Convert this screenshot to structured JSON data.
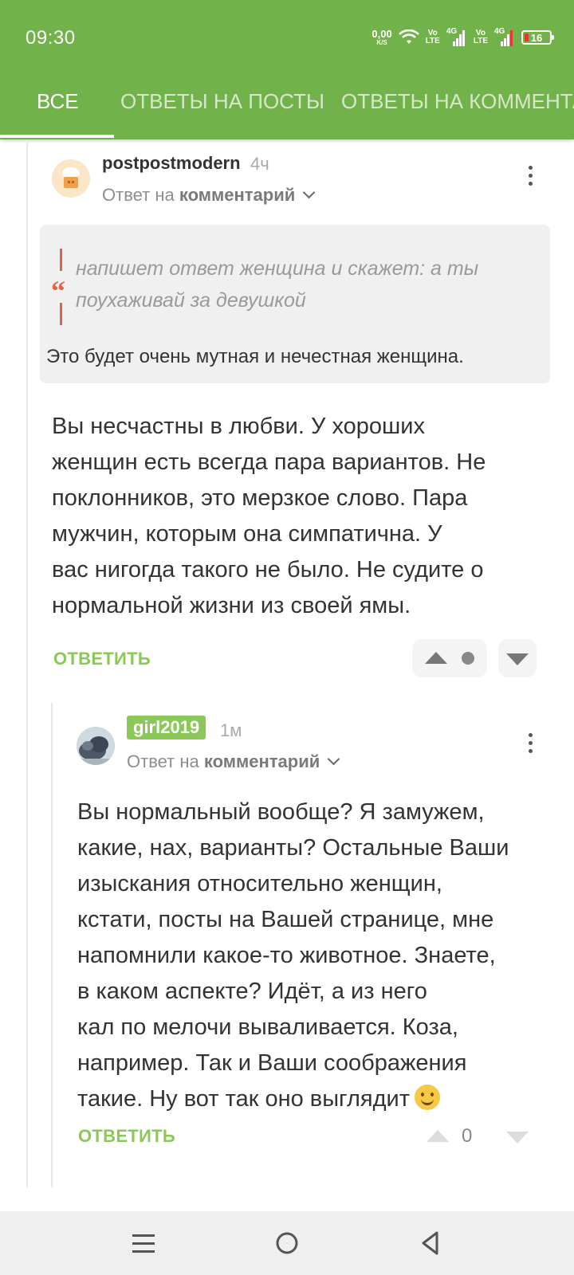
{
  "status_bar": {
    "time": "09:30",
    "net_speed_value": "0,00",
    "net_speed_unit": "K/S",
    "volte1": [
      "Vo",
      "LTE"
    ],
    "sig1_label": "4G",
    "volte2": [
      "Vo",
      "LTE"
    ],
    "sig2_label": "4G",
    "battery": "16"
  },
  "tabs": [
    {
      "label": "Все",
      "active": true
    },
    {
      "label": "Ответы на посты",
      "active": false
    },
    {
      "label": "Ответы на комментарии",
      "active": false
    }
  ],
  "comments": [
    {
      "author": "postpostmodern",
      "time": "4ч",
      "reply_prefix": "Ответ на",
      "reply_target": "комментарий",
      "quote_lines": [
        "напишет ответ женщина и скажет: а ты",
        "поухаживай за девушкой"
      ],
      "quote_mark": "“",
      "quote_reply": "Это будет очень мутная и нечестная женщина.",
      "body_lines": [
        "Вы несчастны в любви. У хороших",
        "женщин есть всегда пара вариантов. Не",
        "поклонников, это мерзкое слово. Пара",
        "мужчин, которым она симпатична. У",
        "вас нигогда такого не было. Не судите о",
        "нормальной жизни из своей ямы."
      ],
      "reply_label": "Ответить"
    },
    {
      "author": "girl2019",
      "time": "1м",
      "reply_prefix": "Ответ на",
      "reply_target": "комментарий",
      "body_lines": [
        "Вы нормальный вообще? Я замужем,",
        "какие, нах, варианты? Остальные Ваши",
        "изыскания относительно женщин,",
        "кстати, посты на Вашей странице, мне",
        "напомнили какое-то животное. Знаете,",
        "в каком аспекте? Идёт, а из него",
        "кал по мелочи вываливается. Коза,",
        "например. Так и Ваши соображения",
        "такие. Ну вот так оно выглядит"
      ],
      "reply_label": "Ответить",
      "score": "0"
    }
  ],
  "colors": {
    "brand_green": "#72b24a",
    "action_green": "#8ac858",
    "quote_accent": "#e2624a"
  }
}
